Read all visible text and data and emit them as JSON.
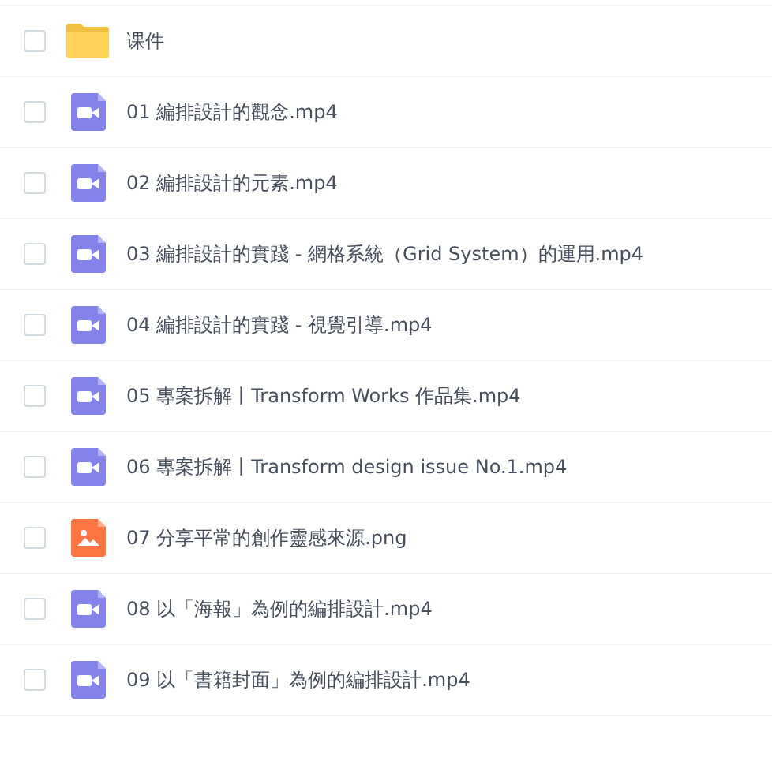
{
  "files": [
    {
      "kind": "folder",
      "name": "课件",
      "checked": false
    },
    {
      "kind": "video",
      "name": "01 編排設計的觀念.mp4",
      "checked": false
    },
    {
      "kind": "video",
      "name": "02 編排設計的元素.mp4",
      "checked": false
    },
    {
      "kind": "video",
      "name": "03 編排設計的實踐 - 網格系統（Grid System）的運用.mp4",
      "checked": false
    },
    {
      "kind": "video",
      "name": "04 編排設計的實踐 - 視覺引導.mp4",
      "checked": false
    },
    {
      "kind": "video",
      "name": "05 專案拆解丨Transform Works 作品集.mp4",
      "checked": false
    },
    {
      "kind": "video",
      "name": "06 專案拆解丨Transform design issue No.1.mp4",
      "checked": false
    },
    {
      "kind": "image",
      "name": "07 分享平常的創作靈感來源.png",
      "checked": false
    },
    {
      "kind": "video",
      "name": "08 以「海報」為例的編排設計.mp4",
      "checked": false
    },
    {
      "kind": "video",
      "name": "09 以「書籍封面」為例的編排設計.mp4",
      "checked": false
    }
  ]
}
